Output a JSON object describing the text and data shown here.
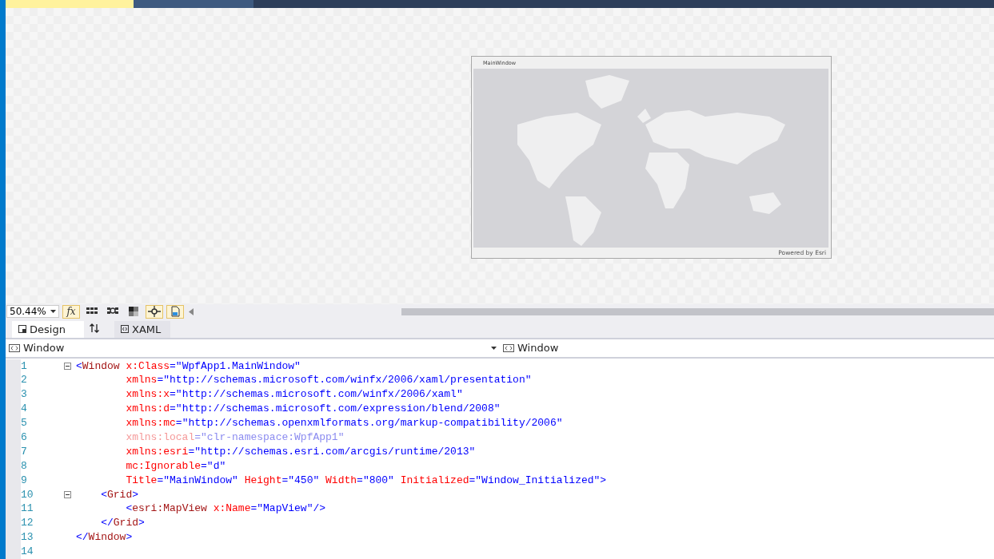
{
  "document_tabs": [
    {
      "selected": true
    },
    {
      "selected": false
    }
  ],
  "designer": {
    "window_title": "MainWindow",
    "attribution": "Powered by Esri"
  },
  "toolbar": {
    "zoom": "50.44%",
    "formula_button": {
      "label": "fx",
      "on": true
    },
    "toggles": [
      {
        "kind": "grid",
        "on": false
      },
      {
        "kind": "snap-grid",
        "on": false
      },
      {
        "kind": "checker",
        "on": false
      },
      {
        "kind": "snap-lines",
        "on": true
      },
      {
        "kind": "device",
        "on": true
      }
    ]
  },
  "view_tabs": [
    {
      "label": "Design",
      "kind": "design",
      "selected": true
    },
    {
      "label": "XAML",
      "kind": "xaml",
      "selected": false
    }
  ],
  "breadcrumbs": [
    {
      "label": "Window"
    },
    {
      "label": "Window"
    }
  ],
  "code_lines": [
    {
      "number": "1",
      "fold": true,
      "faded": false,
      "segments": [
        {
          "kind": "punct",
          "text": "<"
        },
        {
          "kind": "tag",
          "text": "Window"
        },
        {
          "kind": "attr",
          "text": " x:Class"
        },
        {
          "kind": "value",
          "text": "=\"WpfApp1.MainWindow\""
        }
      ]
    },
    {
      "number": "2",
      "fold": false,
      "faded": false,
      "segments": [
        {
          "kind": "attr",
          "text": "        xmlns"
        },
        {
          "kind": "value",
          "text": "=\"http://schemas.microsoft.com/winfx/2006/xaml/presentation\""
        }
      ]
    },
    {
      "number": "3",
      "fold": false,
      "faded": false,
      "segments": [
        {
          "kind": "attr",
          "text": "        xmlns:x"
        },
        {
          "kind": "value",
          "text": "=\"http://schemas.microsoft.com/winfx/2006/xaml\""
        }
      ]
    },
    {
      "number": "4",
      "fold": false,
      "faded": false,
      "segments": [
        {
          "kind": "attr",
          "text": "        xmlns:d"
        },
        {
          "kind": "value",
          "text": "=\"http://schemas.microsoft.com/expression/blend/2008\""
        }
      ]
    },
    {
      "number": "5",
      "fold": false,
      "faded": false,
      "segments": [
        {
          "kind": "attr",
          "text": "        xmlns:mc"
        },
        {
          "kind": "value",
          "text": "=\"http://schemas.openxmlformats.org/markup-compatibility/2006\""
        }
      ]
    },
    {
      "number": "6",
      "fold": false,
      "faded": true,
      "segments": [
        {
          "kind": "attr",
          "text": "        xmlns:local"
        },
        {
          "kind": "value",
          "text": "=\"clr-namespace:WpfApp1\""
        }
      ]
    },
    {
      "number": "7",
      "fold": false,
      "faded": false,
      "segments": [
        {
          "kind": "attr",
          "text": "        xmlns:esri"
        },
        {
          "kind": "value",
          "text": "=\"http://schemas.esri.com/arcgis/runtime/2013\""
        }
      ]
    },
    {
      "number": "8",
      "fold": false,
      "faded": false,
      "segments": [
        {
          "kind": "attr",
          "text": "        mc:Ignorable"
        },
        {
          "kind": "value",
          "text": "=\"d\""
        }
      ]
    },
    {
      "number": "9",
      "fold": false,
      "faded": false,
      "segments": [
        {
          "kind": "attr",
          "text": "        Title"
        },
        {
          "kind": "value",
          "text": "=\"MainWindow\""
        },
        {
          "kind": "attr",
          "text": " Height"
        },
        {
          "kind": "value",
          "text": "=\"450\""
        },
        {
          "kind": "attr",
          "text": " Width"
        },
        {
          "kind": "value",
          "text": "=\"800\""
        },
        {
          "kind": "attr",
          "text": " Initialized"
        },
        {
          "kind": "value",
          "text": "=\"Window_Initialized\">"
        }
      ]
    },
    {
      "number": "10",
      "fold": true,
      "faded": false,
      "segments": [
        {
          "kind": "punct",
          "text": "    <"
        },
        {
          "kind": "tag",
          "text": "Grid"
        },
        {
          "kind": "punct",
          "text": ">"
        }
      ]
    },
    {
      "number": "11",
      "fold": false,
      "faded": false,
      "segments": [
        {
          "kind": "punct",
          "text": "        <"
        },
        {
          "kind": "tag",
          "text": "esri:MapView"
        },
        {
          "kind": "attr",
          "text": " x:Name"
        },
        {
          "kind": "value",
          "text": "=\"MapView\"/>"
        }
      ]
    },
    {
      "number": "12",
      "fold": false,
      "faded": false,
      "segments": [
        {
          "kind": "punct",
          "text": "    </"
        },
        {
          "kind": "tag",
          "text": "Grid"
        },
        {
          "kind": "punct",
          "text": ">"
        }
      ]
    },
    {
      "number": "13",
      "fold": false,
      "faded": false,
      "segments": [
        {
          "kind": "punct",
          "text": "</"
        },
        {
          "kind": "tag",
          "text": "Window"
        },
        {
          "kind": "punct",
          "text": ">"
        }
      ]
    },
    {
      "number": "14",
      "fold": false,
      "faded": false
    }
  ]
}
